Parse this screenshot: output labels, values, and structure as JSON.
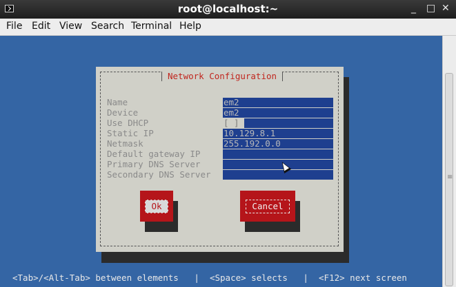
{
  "window": {
    "title": "root@localhost:~",
    "minimize": "_",
    "maximize": "□",
    "close": "✕"
  },
  "menu": [
    "File",
    "Edit",
    "View",
    "Search",
    "Terminal",
    "Help"
  ],
  "dialog": {
    "title": "Network Configuration",
    "labels": [
      "Name",
      "Device",
      "Use DHCP",
      "Static IP",
      "Netmask",
      "Default gateway IP",
      "Primary DNS Server",
      "Secondary DNS Server"
    ],
    "name_value": "em2",
    "device_value": "em2",
    "dhcp_value": "[ ]",
    "static_ip_value": "10.129.8.1",
    "netmask_value": "255.192.0.0",
    "gateway_value": "",
    "primary_dns_value": "",
    "secondary_dns_value": "",
    "ok_label": "Ok",
    "cancel_label": "Cancel"
  },
  "status_bar": "<Tab>/<Alt-Tab> between elements   |  <Space> selects   |  <F12> next screen",
  "colors": {
    "terminal_bg": "#3465a4",
    "dialog_bg": "#d0d0c8",
    "field_bg": "#1e3f8f",
    "button_red": "#b5151a",
    "title_red": "#c0261e"
  }
}
